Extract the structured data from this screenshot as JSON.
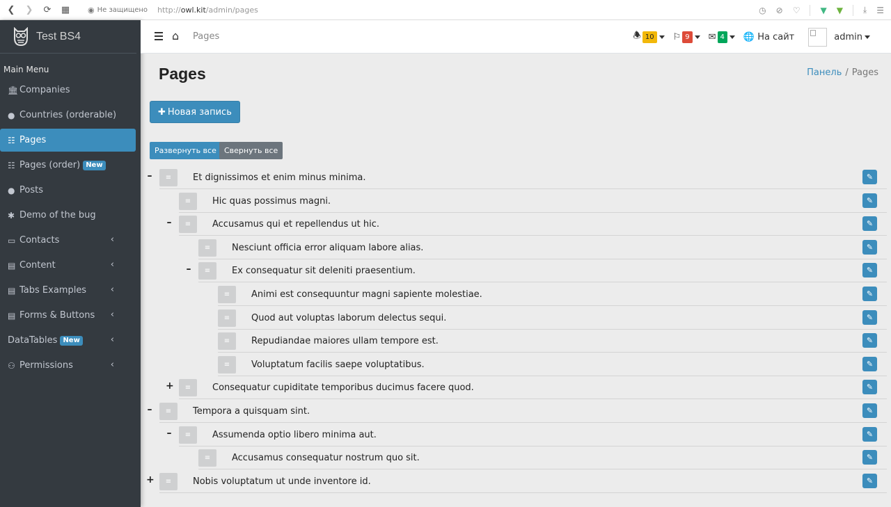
{
  "browser": {
    "insecure": "Не защищено",
    "url_prefix": "http://",
    "url_host": "owl.kit",
    "url_path": "/admin/pages"
  },
  "brand": {
    "name": "Test BS4"
  },
  "sidebar": {
    "header": "Main Menu",
    "items": [
      {
        "label": "Companies",
        "icon": "bank-icon"
      },
      {
        "label": "Countries (orderable)",
        "icon": "globe-icon"
      },
      {
        "label": "Pages",
        "icon": "sitemap-icon",
        "active": true
      },
      {
        "label": "Pages (order)",
        "icon": "sitemap-icon",
        "badge": "New"
      },
      {
        "label": "Posts",
        "icon": "globe-icon"
      },
      {
        "label": "Demo of the bug",
        "icon": "bug-icon"
      },
      {
        "label": "Contacts",
        "icon": "credit-card-icon",
        "arrow": true
      },
      {
        "label": "Content",
        "icon": "newspaper-icon",
        "arrow": true
      },
      {
        "label": "Tabs Examples",
        "icon": "newspaper-icon",
        "arrow": true
      },
      {
        "label": "Forms & Buttons",
        "icon": "newspaper-icon",
        "arrow": true
      },
      {
        "label": "DataTables",
        "icon": "",
        "badge": "New",
        "arrow": true
      },
      {
        "label": "Permissions",
        "icon": "users-icon",
        "arrow": true
      }
    ]
  },
  "topnav": {
    "crumb": "Pages",
    "notifications_count": "10",
    "flags_count": "9",
    "messages_count": "4",
    "site_link": "На сайт",
    "user": "admin"
  },
  "page": {
    "title": "Pages",
    "breadcrumb_link": "Панель",
    "breadcrumb_current": "Pages",
    "new_button": "Новая запись",
    "expand_all": "Развернуть все",
    "collapse_all": "Свернуть все"
  },
  "tree": [
    {
      "title": "Et dignissimos et enim minus minima.",
      "level": 0,
      "toggle": "–"
    },
    {
      "title": "Hic quas possimus magni.",
      "level": 1,
      "toggle": ""
    },
    {
      "title": "Accusamus qui et repellendus ut hic.",
      "level": 1,
      "toggle": "–"
    },
    {
      "title": "Nesciunt officia error aliquam labore alias.",
      "level": 2,
      "toggle": ""
    },
    {
      "title": "Ex consequatur sit deleniti praesentium.",
      "level": 2,
      "toggle": "–"
    },
    {
      "title": "Animi est consequuntur magni sapiente molestiae.",
      "level": 3,
      "toggle": ""
    },
    {
      "title": "Quod aut voluptas laborum delectus sequi.",
      "level": 3,
      "toggle": ""
    },
    {
      "title": "Repudiandae maiores ullam tempore est.",
      "level": 3,
      "toggle": ""
    },
    {
      "title": "Voluptatum facilis saepe voluptatibus.",
      "level": 3,
      "toggle": ""
    },
    {
      "title": "Consequatur cupiditate temporibus ducimus facere quod.",
      "level": 1,
      "toggle": "+"
    },
    {
      "title": "Tempora a quisquam sint.",
      "level": 0,
      "toggle": "–"
    },
    {
      "title": "Assumenda optio libero minima aut.",
      "level": 1,
      "toggle": "–"
    },
    {
      "title": "Accusamus consequatur nostrum quo sit.",
      "level": 2,
      "toggle": ""
    },
    {
      "title": "Nobis voluptatum ut unde inventore id.",
      "level": 0,
      "toggle": "+"
    }
  ],
  "colors": {
    "primary": "#3c8dbc",
    "sidebar_bg": "#343a40",
    "warning": "#f2b80a",
    "danger": "#dd4b39",
    "success": "#00a65a",
    "secondary": "#6c757d"
  }
}
